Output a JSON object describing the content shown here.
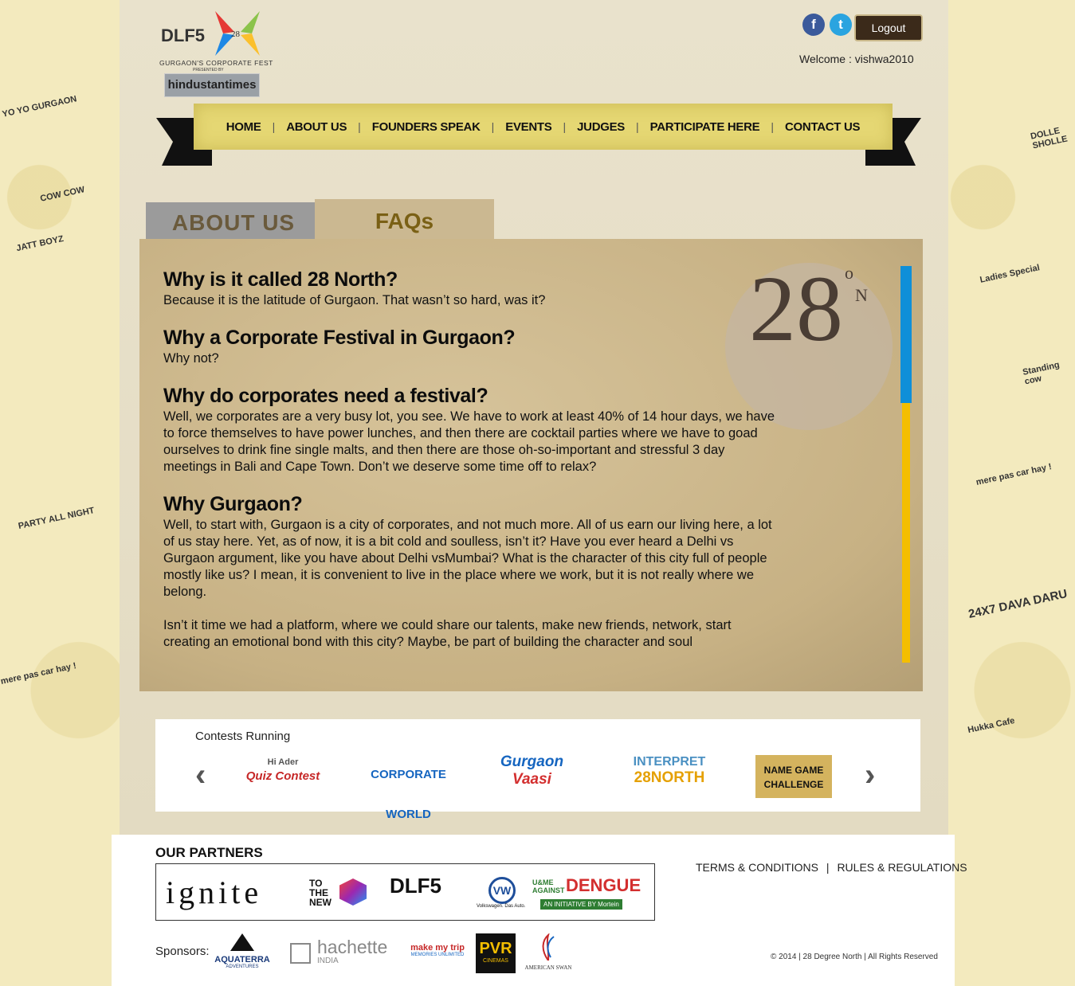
{
  "header": {
    "logo_text": "DLF5",
    "logo_tagline": "GURGAON'S CORPORATE FEST",
    "logo_presented": "PRESENTED BY",
    "logo_partner": "hindustantimes",
    "facebook_glyph": "f",
    "twitter_glyph": "t",
    "logout_label": "Logout",
    "welcome_text": "Welcome : vishwa2010"
  },
  "nav": {
    "items": [
      {
        "label": "HOME"
      },
      {
        "label": "ABOUT US"
      },
      {
        "label": "FOUNDERS SPEAK"
      },
      {
        "label": "EVENTS"
      },
      {
        "label": "JUDGES"
      },
      {
        "label": "PARTICIPATE HERE"
      },
      {
        "label": "CONTACT US"
      }
    ],
    "separator": "|"
  },
  "tabs": {
    "about": "ABOUT US",
    "faq": "FAQs"
  },
  "badge": {
    "number": "28",
    "sup_o": "o",
    "letter": "N"
  },
  "faqs": [
    {
      "q": "Why is it called 28 North?",
      "a": [
        "Because it is the latitude of Gurgaon. That wasn’t so hard, was it?"
      ]
    },
    {
      "q": "Why a Corporate Festival in Gurgaon?",
      "a": [
        "Why not?"
      ]
    },
    {
      "q": "Why do corporates need a festival?",
      "a": [
        "Well, we corporates are a very busy lot, you see. We have to work at least 40% of 14 hour days, we have to force themselves to have power lunches, and then there are cocktail parties where we have to goad ourselves to drink fine single malts, and then there are those oh-so-important and stressful 3 day meetings in Bali and Cape Town. Don’t we deserve some time off to relax?"
      ]
    },
    {
      "q": "Why Gurgaon?",
      "a": [
        "Well, to start with, Gurgaon is a city of corporates, and not much more. All of us earn our living here, a lot of us stay here. Yet, as of now, it is a bit cold and soulless, isn’t it? Have you ever heard a Delhi vs Gurgaon argument, like you have about Delhi vsMumbai? What is the character of this city full of people mostly like us? I mean, it is convenient to live in the place where we work, but it is not really where we belong.",
        "Isn’t it time we had a platform, where we could share our talents, make new friends, network, start creating an emotional bond with this city? Maybe, be part of building the character and soul"
      ]
    }
  ],
  "contests": {
    "label": "Contests Running",
    "prev": "‹",
    "next": "›",
    "logos": [
      {
        "line1": "Hi Ader",
        "line2": "Quiz Contest"
      },
      {
        "line1": "CORPORATE WORLD",
        "line2": ""
      },
      {
        "line1": "Gurgaon",
        "line2": "Vaasi"
      },
      {
        "line1": "INTERPRET",
        "line2": "28NORTH"
      },
      {
        "line1": "NAME GAME",
        "line2": "CHALLENGE"
      }
    ]
  },
  "partners": {
    "title": "OUR PARTNERS",
    "ignite": "ignite",
    "tothenew": "TO THE NEW",
    "dlf": "DLF5",
    "vw_caption": "Volkswagen. Das Auto.",
    "dengue_top": "U&ME AGAINST",
    "dengue_main": "DENGUE",
    "dengue_sub": "AN INITIATIVE BY Mortein"
  },
  "sponsors": {
    "label": "Sponsors:",
    "aquaterra": "AQUATERRA",
    "aquaterra_sub": "ADVENTURES",
    "hachette": "hachette",
    "hachette_sub": "INDIA",
    "makemytrip": "make my trip",
    "makemytrip_sub": "MEMORIES UNLIMITED",
    "pvr": "PVR",
    "pvr_sub": "CINEMAS",
    "swan": "AMERICAN SWAN"
  },
  "footer_links": {
    "terms": "TERMS & CONDITIONS",
    "sep": "|",
    "rules": "RULES & REGULATIONS",
    "copyright": "© 2014 | 28 Degree North | All Rights Reserved"
  },
  "doodles": {
    "yoyo": "YO YO GURGAON",
    "cowcow": "COW COW",
    "party": "PARTY ALL NIGHT",
    "jatt": "JATT BOYZ",
    "dolle": "DOLLE SHOLLE",
    "ladies": "Ladies Special",
    "standing": "Standing cow",
    "mere": "mere pas car hay !",
    "dava": "24X7 DAVA DARU",
    "hukka": "Hukka Cafe"
  },
  "colors": {
    "nav_yellow": "#e5d773",
    "scroll_blue": "#0f8fd8",
    "scroll_yellow": "#f4be00",
    "facebook": "#3b5a9b",
    "twitter": "#2aa4e0"
  }
}
